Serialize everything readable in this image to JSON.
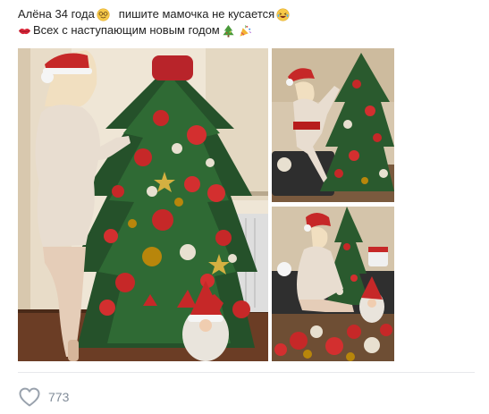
{
  "post": {
    "line1_part1": "Алёна 34 года",
    "line1_part2": "пишите мамочка не кусается",
    "line2": "Всех с наступающим новым годом",
    "emoji": {
      "line1_a": "smiling-face-with-glasses",
      "line1_b": "laughing-face",
      "line2_lips": "lips",
      "line2_tree": "christmas-tree",
      "line2_popper": "party-popper"
    }
  },
  "gallery": {
    "photos": [
      {
        "name": "woman-decorating-christmas-tree"
      },
      {
        "name": "woman-hanging-ornament"
      },
      {
        "name": "woman-sitting-with-toys"
      }
    ]
  },
  "actions": {
    "like_count": "773"
  },
  "colors": {
    "text": "#222222",
    "muted": "#818c99",
    "divider": "#e7e8ec",
    "like_icon": "#99a2ad"
  }
}
